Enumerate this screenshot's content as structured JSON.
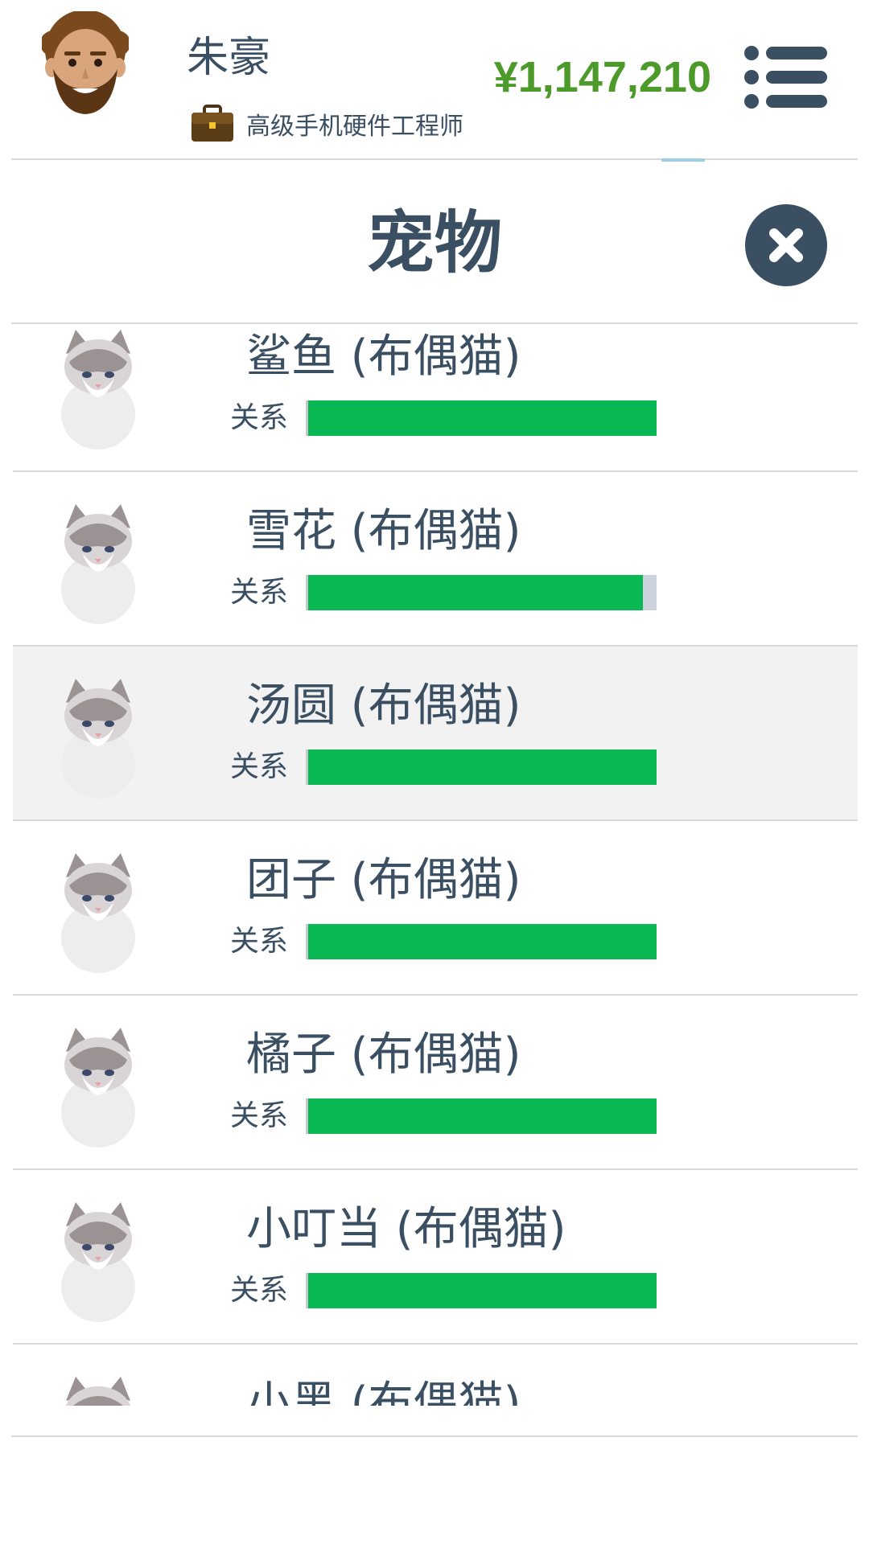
{
  "header": {
    "user_name": "朱豪",
    "job_title": "高级手机硬件工程师",
    "money": "¥1,147,210",
    "avatar_icon": "bearded-man-avatar-icon",
    "job_icon": "briefcase-icon",
    "menu_icon": "list-menu-icon"
  },
  "panel": {
    "title": "宠物",
    "close_icon": "close-icon"
  },
  "relationship_label": "关系",
  "colors": {
    "bar_fill": "#0ab953",
    "bar_track": "#ccd3dc",
    "text": "#3b4f63",
    "money": "#4c9a2a"
  },
  "pets": [
    {
      "name": "鲨鱼 (布偶猫)",
      "relationship": 1.0
    },
    {
      "name": "雪花 (布偶猫)",
      "relationship": 0.96
    },
    {
      "name": "汤圆 (布偶猫)",
      "relationship": 1.0
    },
    {
      "name": "团子 (布偶猫)",
      "relationship": 1.0
    },
    {
      "name": "橘子 (布偶猫)",
      "relationship": 1.0
    },
    {
      "name": "小叮当 (布偶猫)",
      "relationship": 1.0
    },
    {
      "name": "小黑 (布偶猫)",
      "relationship": null
    }
  ]
}
